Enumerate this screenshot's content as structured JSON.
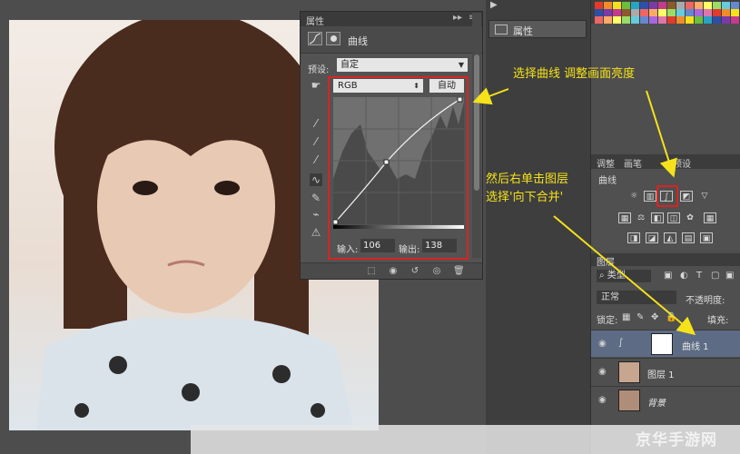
{
  "properties_panel": {
    "title": "属性",
    "subtitle": "曲线",
    "preset_label": "预设:",
    "preset_value": "自定",
    "channel": "RGB",
    "auto_button": "自动",
    "input_label": "输入:",
    "input_value": "106",
    "output_label": "输出:",
    "output_value": "138"
  },
  "dock": {
    "properties_item": "属性"
  },
  "adjustments": {
    "tabs": [
      "调整",
      "画笔",
      "预设"
    ],
    "title": "曲线"
  },
  "layers": {
    "tab": "图层",
    "kind_filter": "类型",
    "blend_mode": "正常",
    "opacity_label": "不透明度:",
    "lock_label": "锁定:",
    "fill_label": "填充:",
    "rows": [
      {
        "name": "曲线 1"
      },
      {
        "name": "图层 1"
      },
      {
        "name": "背景"
      }
    ]
  },
  "annotations": {
    "select_curves": "选择曲线 调整画面亮度",
    "then_right_click_line1": "然后右单击图层",
    "then_right_click_line2": "选择'向下合并'"
  },
  "watermark": "京华手游网",
  "colors": {
    "highlight_red": "#d62424",
    "annotation_yellow": "#f5e21b"
  }
}
